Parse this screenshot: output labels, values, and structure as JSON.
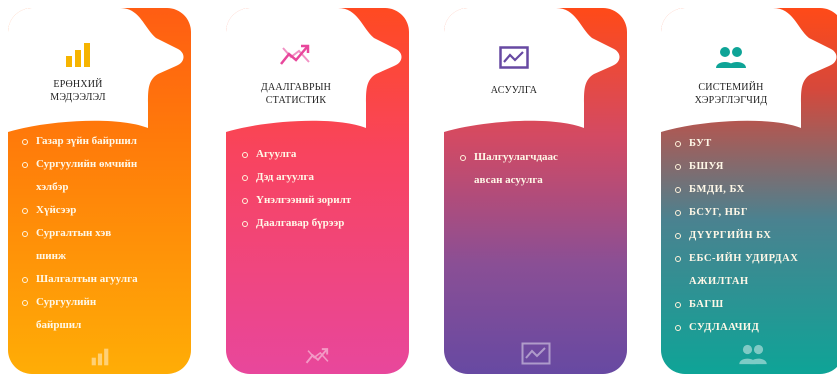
{
  "cards": [
    {
      "title_line1": "ЕРӨНХИЙ",
      "title_line2": "МЭДЭЭЛЭЛ",
      "icon": "bar-chart-icon",
      "items": [
        "Газар зүйн байршил",
        "Сургуулийн өмчийн",
        "хэлбэр",
        "Хүйсээр",
        "Сургалтын хэв",
        "шинж",
        "Шалгалтын агуулга",
        "Сургуулийн",
        "байршил"
      ]
    },
    {
      "title_line1": "ДААЛГАВРЫН",
      "title_line2": "СТАТИСТИК",
      "icon": "trend-up-arrow-icon",
      "items": [
        "Агуулга",
        "Дэд агуулга",
        "Үнэлгээний зорилт",
        "Даалгавар бүрээр"
      ]
    },
    {
      "title_line1": "АСУУЛГА",
      "title_line2": "",
      "icon": "line-chart-monitor-icon",
      "items": [
        "Шалгуулагчдаас",
        "авсан асуулга"
      ]
    },
    {
      "title_line1": "СИСТЕМИЙН",
      "title_line2": "ХЭРЭГЛЭГЧИД",
      "icon": "users-group-icon",
      "items": [
        "БУТ",
        "БШУЯ",
        "БМДИ, БХ",
        "БСУГ, НБГ",
        "ДҮҮРГИЙН БХ",
        "ЕБС-ИЙН УДИРДАХ",
        "АЖИЛТАН",
        "БАГШ",
        "СУДЛААЧИД"
      ]
    }
  ],
  "colors": {
    "orange": "#ff7a0a",
    "pink": "#e8479c",
    "purple": "#6749a2",
    "teal": "#0ea497"
  }
}
